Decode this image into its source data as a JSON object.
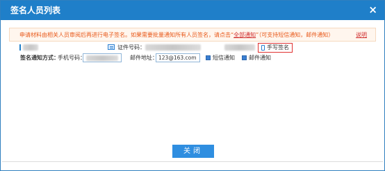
{
  "dialog": {
    "title": "签名人员列表",
    "close_glyph": "×"
  },
  "notice": {
    "text_before": "申请材料由相关人员审阅后再进行电子签名。如果需要批量通知所有人员签名，请点击“",
    "link": "全部通知",
    "text_after": "”（可支持短信通知，邮件通知）",
    "help_link": "说明"
  },
  "person": {
    "id_label": "证件号码：",
    "handwrite_label": "手写签名"
  },
  "notify": {
    "method_label": "签名通知方式：",
    "phone_label": "手机号码：",
    "email_label": "邮件地址：",
    "email_value": "123@163.com",
    "sms_label": "短信通知",
    "mail_label": "邮件通知"
  },
  "footer": {
    "close_button": "关闭"
  },
  "colors": {
    "title_bar": "#1f7fc9",
    "notice_text": "#e8591a",
    "highlight_border": "#e0302f",
    "button": "#2f8ee0"
  }
}
